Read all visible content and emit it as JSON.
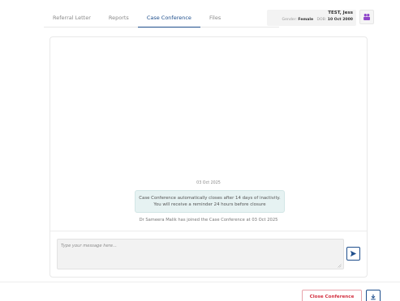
{
  "tabs": [
    {
      "label": "Referral Letter",
      "active": false
    },
    {
      "label": "Reports",
      "active": false
    },
    {
      "label": "Case Conference",
      "active": true
    },
    {
      "label": "Files",
      "active": false
    }
  ],
  "patient": {
    "name": "TEST, Jess",
    "gender_label": "Gender:",
    "gender": "Female",
    "dob_label": "DOB:",
    "dob": "10 Oct 2000",
    "avatar_icon": "people-icon"
  },
  "chat": {
    "date": "03 Oct 2025",
    "system_message": {
      "line1": "Case Conference automatically closes after 14 days of inactivity.",
      "line2": "You will receive a reminder 24 hours before closure"
    },
    "join_message": "Dr Sameera Malik has joined the Case Conference at 03 Oct 2025",
    "input_placeholder": "Type your message here...",
    "input_value": "",
    "send_icon": "send-icon"
  },
  "footer": {
    "close_label": "Close Conference",
    "download_icon": "download-icon"
  },
  "colors": {
    "accent": "#1e4e8c",
    "danger": "#d32f3f",
    "avatar": "#8e44c9",
    "system_bg": "#e6f2f2"
  }
}
